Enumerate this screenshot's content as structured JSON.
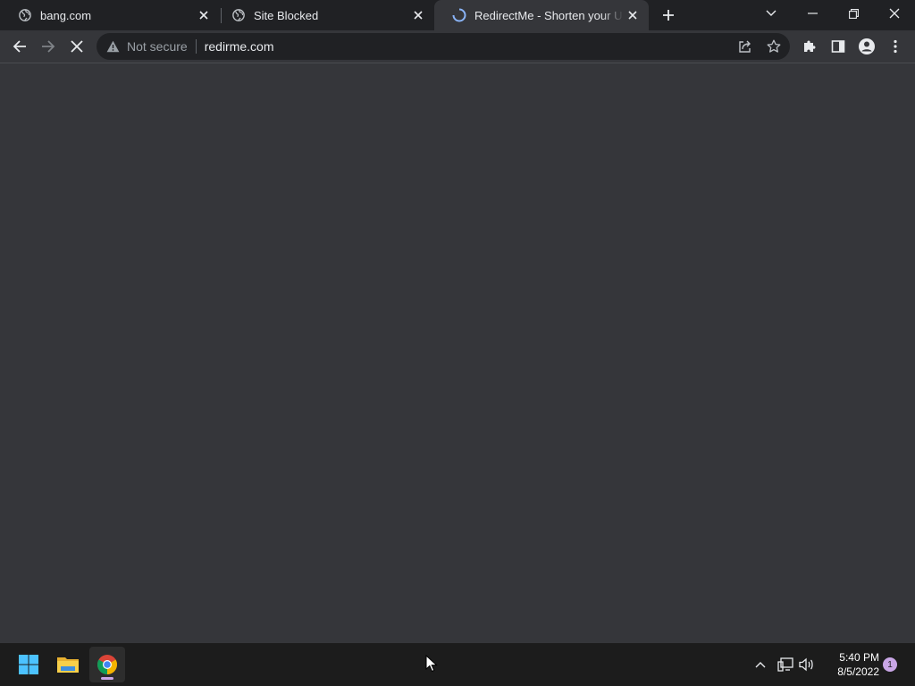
{
  "tabs": [
    {
      "title": "bang.com",
      "icon": "globe-icon",
      "active": false
    },
    {
      "title": "Site Blocked",
      "icon": "globe-icon",
      "active": false
    },
    {
      "title": "RedirectMe - Shorten your URL to",
      "icon": "loading-spinner-icon",
      "active": true
    }
  ],
  "omnibox": {
    "security_label": "Not secure",
    "url": "redirme.com"
  },
  "taskbar": {
    "clock_time": "5:40 PM",
    "clock_date": "8/5/2022",
    "notification_count": "1"
  },
  "colors": {
    "tab_strip": "#202124",
    "toolbar": "#35363a",
    "content": "#35363a",
    "taskbar": "#1c1c1c",
    "accent": "#8ab4f8"
  }
}
